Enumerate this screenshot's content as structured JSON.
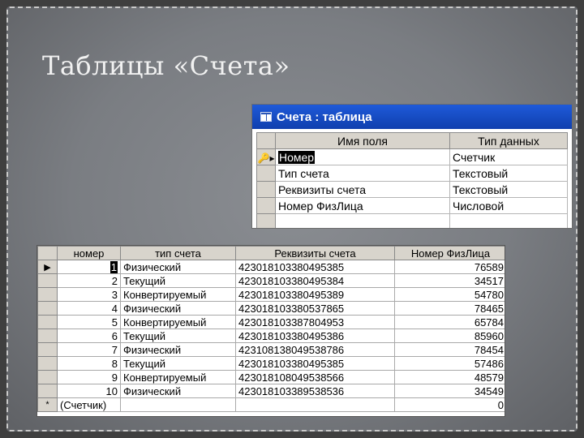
{
  "slide": {
    "title": "Таблицы «Счета»"
  },
  "design_window": {
    "title": "Счета : таблица",
    "columns": [
      "Имя поля",
      "Тип данных"
    ],
    "fields": [
      {
        "name": "Номер",
        "type": "Счетчик",
        "key": true
      },
      {
        "name": "Тип счета",
        "type": "Текстовый"
      },
      {
        "name": "Реквизиты счета",
        "type": "Текстовый"
      },
      {
        "name": "Номер ФизЛица",
        "type": "Числовой"
      },
      {
        "name": "",
        "type": ""
      }
    ],
    "key_icon": "primary-key-icon"
  },
  "datasheet": {
    "columns": [
      "номер",
      "тип счета",
      "Реквизиты счета",
      "Номер ФизЛица"
    ],
    "rows": [
      [
        "1",
        "Физический",
        "42301810338049538​5",
        "76589"
      ],
      [
        "2",
        "Текущий",
        "42301810338049538​4",
        "34517"
      ],
      [
        "3",
        "Конвертируемый",
        "42301810338049538​9",
        "54780"
      ],
      [
        "4",
        "Физический",
        "42301810338053786​5",
        "78465"
      ],
      [
        "5",
        "Конвертируемый",
        "42301810338780495​3",
        "65784"
      ],
      [
        "6",
        "Текущий",
        "42301810338049538​6",
        "85960"
      ],
      [
        "7",
        "Физический",
        "42310813804953878​6",
        "78454"
      ],
      [
        "8",
        "Текущий",
        "42301810338049538​5",
        "57486"
      ],
      [
        "9",
        "Конвертируемый",
        "42301810804953856​6",
        "48579"
      ],
      [
        "10",
        "Физический",
        "42301810338953853​6",
        "34549"
      ]
    ],
    "new_row": {
      "marker": "*",
      "counter": "(Счетчик)",
      "value": "0"
    },
    "current_row_marker": "▶"
  }
}
